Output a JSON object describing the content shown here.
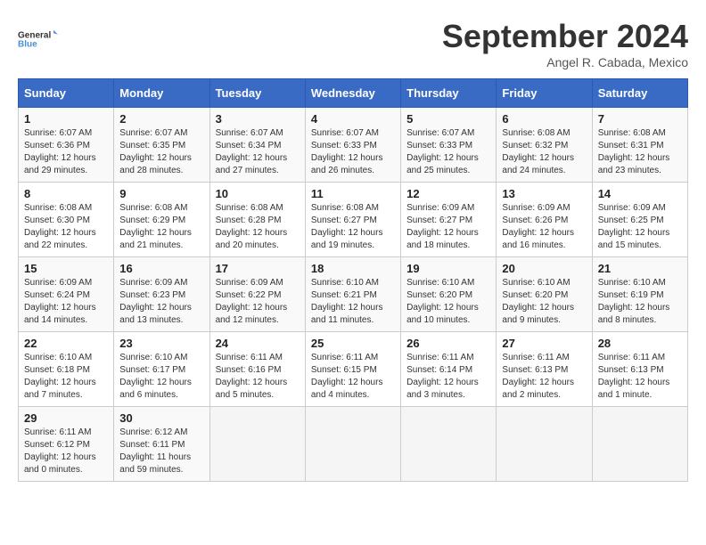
{
  "logo": {
    "line1": "General",
    "line2": "Blue"
  },
  "title": "September 2024",
  "subtitle": "Angel R. Cabada, Mexico",
  "days_header": [
    "Sunday",
    "Monday",
    "Tuesday",
    "Wednesday",
    "Thursday",
    "Friday",
    "Saturday"
  ],
  "weeks": [
    [
      {
        "day": "1",
        "info": "Sunrise: 6:07 AM\nSunset: 6:36 PM\nDaylight: 12 hours\nand 29 minutes."
      },
      {
        "day": "2",
        "info": "Sunrise: 6:07 AM\nSunset: 6:35 PM\nDaylight: 12 hours\nand 28 minutes."
      },
      {
        "day": "3",
        "info": "Sunrise: 6:07 AM\nSunset: 6:34 PM\nDaylight: 12 hours\nand 27 minutes."
      },
      {
        "day": "4",
        "info": "Sunrise: 6:07 AM\nSunset: 6:33 PM\nDaylight: 12 hours\nand 26 minutes."
      },
      {
        "day": "5",
        "info": "Sunrise: 6:07 AM\nSunset: 6:33 PM\nDaylight: 12 hours\nand 25 minutes."
      },
      {
        "day": "6",
        "info": "Sunrise: 6:08 AM\nSunset: 6:32 PM\nDaylight: 12 hours\nand 24 minutes."
      },
      {
        "day": "7",
        "info": "Sunrise: 6:08 AM\nSunset: 6:31 PM\nDaylight: 12 hours\nand 23 minutes."
      }
    ],
    [
      {
        "day": "8",
        "info": "Sunrise: 6:08 AM\nSunset: 6:30 PM\nDaylight: 12 hours\nand 22 minutes."
      },
      {
        "day": "9",
        "info": "Sunrise: 6:08 AM\nSunset: 6:29 PM\nDaylight: 12 hours\nand 21 minutes."
      },
      {
        "day": "10",
        "info": "Sunrise: 6:08 AM\nSunset: 6:28 PM\nDaylight: 12 hours\nand 20 minutes."
      },
      {
        "day": "11",
        "info": "Sunrise: 6:08 AM\nSunset: 6:27 PM\nDaylight: 12 hours\nand 19 minutes."
      },
      {
        "day": "12",
        "info": "Sunrise: 6:09 AM\nSunset: 6:27 PM\nDaylight: 12 hours\nand 18 minutes."
      },
      {
        "day": "13",
        "info": "Sunrise: 6:09 AM\nSunset: 6:26 PM\nDaylight: 12 hours\nand 16 minutes."
      },
      {
        "day": "14",
        "info": "Sunrise: 6:09 AM\nSunset: 6:25 PM\nDaylight: 12 hours\nand 15 minutes."
      }
    ],
    [
      {
        "day": "15",
        "info": "Sunrise: 6:09 AM\nSunset: 6:24 PM\nDaylight: 12 hours\nand 14 minutes."
      },
      {
        "day": "16",
        "info": "Sunrise: 6:09 AM\nSunset: 6:23 PM\nDaylight: 12 hours\nand 13 minutes."
      },
      {
        "day": "17",
        "info": "Sunrise: 6:09 AM\nSunset: 6:22 PM\nDaylight: 12 hours\nand 12 minutes."
      },
      {
        "day": "18",
        "info": "Sunrise: 6:10 AM\nSunset: 6:21 PM\nDaylight: 12 hours\nand 11 minutes."
      },
      {
        "day": "19",
        "info": "Sunrise: 6:10 AM\nSunset: 6:20 PM\nDaylight: 12 hours\nand 10 minutes."
      },
      {
        "day": "20",
        "info": "Sunrise: 6:10 AM\nSunset: 6:20 PM\nDaylight: 12 hours\nand 9 minutes."
      },
      {
        "day": "21",
        "info": "Sunrise: 6:10 AM\nSunset: 6:19 PM\nDaylight: 12 hours\nand 8 minutes."
      }
    ],
    [
      {
        "day": "22",
        "info": "Sunrise: 6:10 AM\nSunset: 6:18 PM\nDaylight: 12 hours\nand 7 minutes."
      },
      {
        "day": "23",
        "info": "Sunrise: 6:10 AM\nSunset: 6:17 PM\nDaylight: 12 hours\nand 6 minutes."
      },
      {
        "day": "24",
        "info": "Sunrise: 6:11 AM\nSunset: 6:16 PM\nDaylight: 12 hours\nand 5 minutes."
      },
      {
        "day": "25",
        "info": "Sunrise: 6:11 AM\nSunset: 6:15 PM\nDaylight: 12 hours\nand 4 minutes."
      },
      {
        "day": "26",
        "info": "Sunrise: 6:11 AM\nSunset: 6:14 PM\nDaylight: 12 hours\nand 3 minutes."
      },
      {
        "day": "27",
        "info": "Sunrise: 6:11 AM\nSunset: 6:13 PM\nDaylight: 12 hours\nand 2 minutes."
      },
      {
        "day": "28",
        "info": "Sunrise: 6:11 AM\nSunset: 6:13 PM\nDaylight: 12 hours\nand 1 minute."
      }
    ],
    [
      {
        "day": "29",
        "info": "Sunrise: 6:11 AM\nSunset: 6:12 PM\nDaylight: 12 hours\nand 0 minutes."
      },
      {
        "day": "30",
        "info": "Sunrise: 6:12 AM\nSunset: 6:11 PM\nDaylight: 11 hours\nand 59 minutes."
      },
      {
        "day": "",
        "info": ""
      },
      {
        "day": "",
        "info": ""
      },
      {
        "day": "",
        "info": ""
      },
      {
        "day": "",
        "info": ""
      },
      {
        "day": "",
        "info": ""
      }
    ]
  ]
}
